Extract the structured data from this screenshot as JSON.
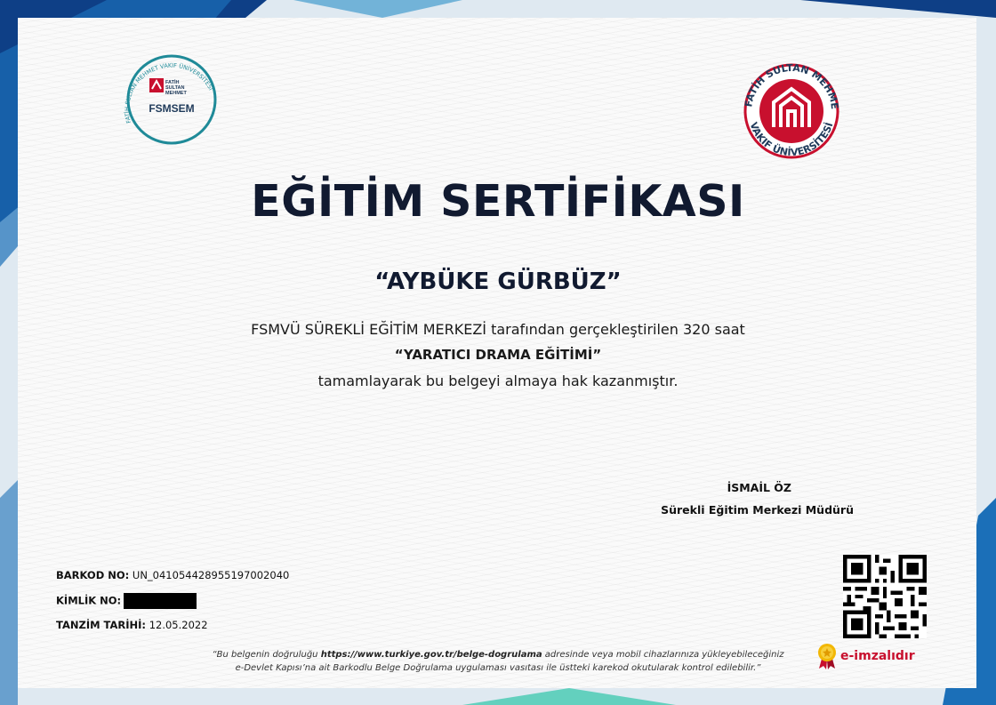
{
  "certificate": {
    "title": "EĞİTİM SERTİFİKASI",
    "recipient_name": "“AYBÜKE GÜRBÜZ”",
    "line1": "FSMVÜ SÜREKLİ EĞİTİM MERKEZİ tarafından gerçekleştirilen 320 saat",
    "course_name": "“YARATICI DRAMA EĞİTİMİ”",
    "line3": "tamamlayarak bu belgeyi almaya hak kazanmıştır."
  },
  "signatory": {
    "name": "İSMAİL ÖZ",
    "position": "Sürekli Eğitim Merkezi Müdürü"
  },
  "meta": {
    "barcode_label": "BARKOD NO:",
    "barcode_value": "UN_041054428955197002040",
    "id_label": "KİMLİK NO:",
    "date_label": "TANZİM TARİHİ:",
    "date_value": "12.05.2022"
  },
  "footnote": {
    "part1": "“Bu belgenin doğruluğu ",
    "url": "https://www.turkiye.gov.tr/belge-dogrulama",
    "part2": " adresinde veya mobil cihazlarınıza yükleyebileceğiniz",
    "line2": "e-Devlet Kapısı’na ait Barkodlu Belge Doğrulama uygulaması vasıtası ile üstteki karekod okutularak kontrol edilebilir.”"
  },
  "esign": {
    "label": "e-imzalıdır"
  },
  "logos": {
    "left": {
      "ring_text": "FATİH SULTAN MEHMET VAKIF ÜNİVERSİTESİ",
      "ring_text_right": "SÜREKLİ EĞİTİM MERKEZİ",
      "inner_text_1": "FATİH",
      "inner_text_2": "SULTAN",
      "inner_text_3": "MEHMET",
      "abbr": "FSMSEM"
    },
    "right": {
      "ring_text_top": "FATİH SULTAN MEHMET",
      "ring_text_bottom": "VAKIF ÜNİVERSİTESİ"
    }
  },
  "colors": {
    "title": "#111a30",
    "brand_red": "#c8102e",
    "teal": "#1f8a98"
  }
}
